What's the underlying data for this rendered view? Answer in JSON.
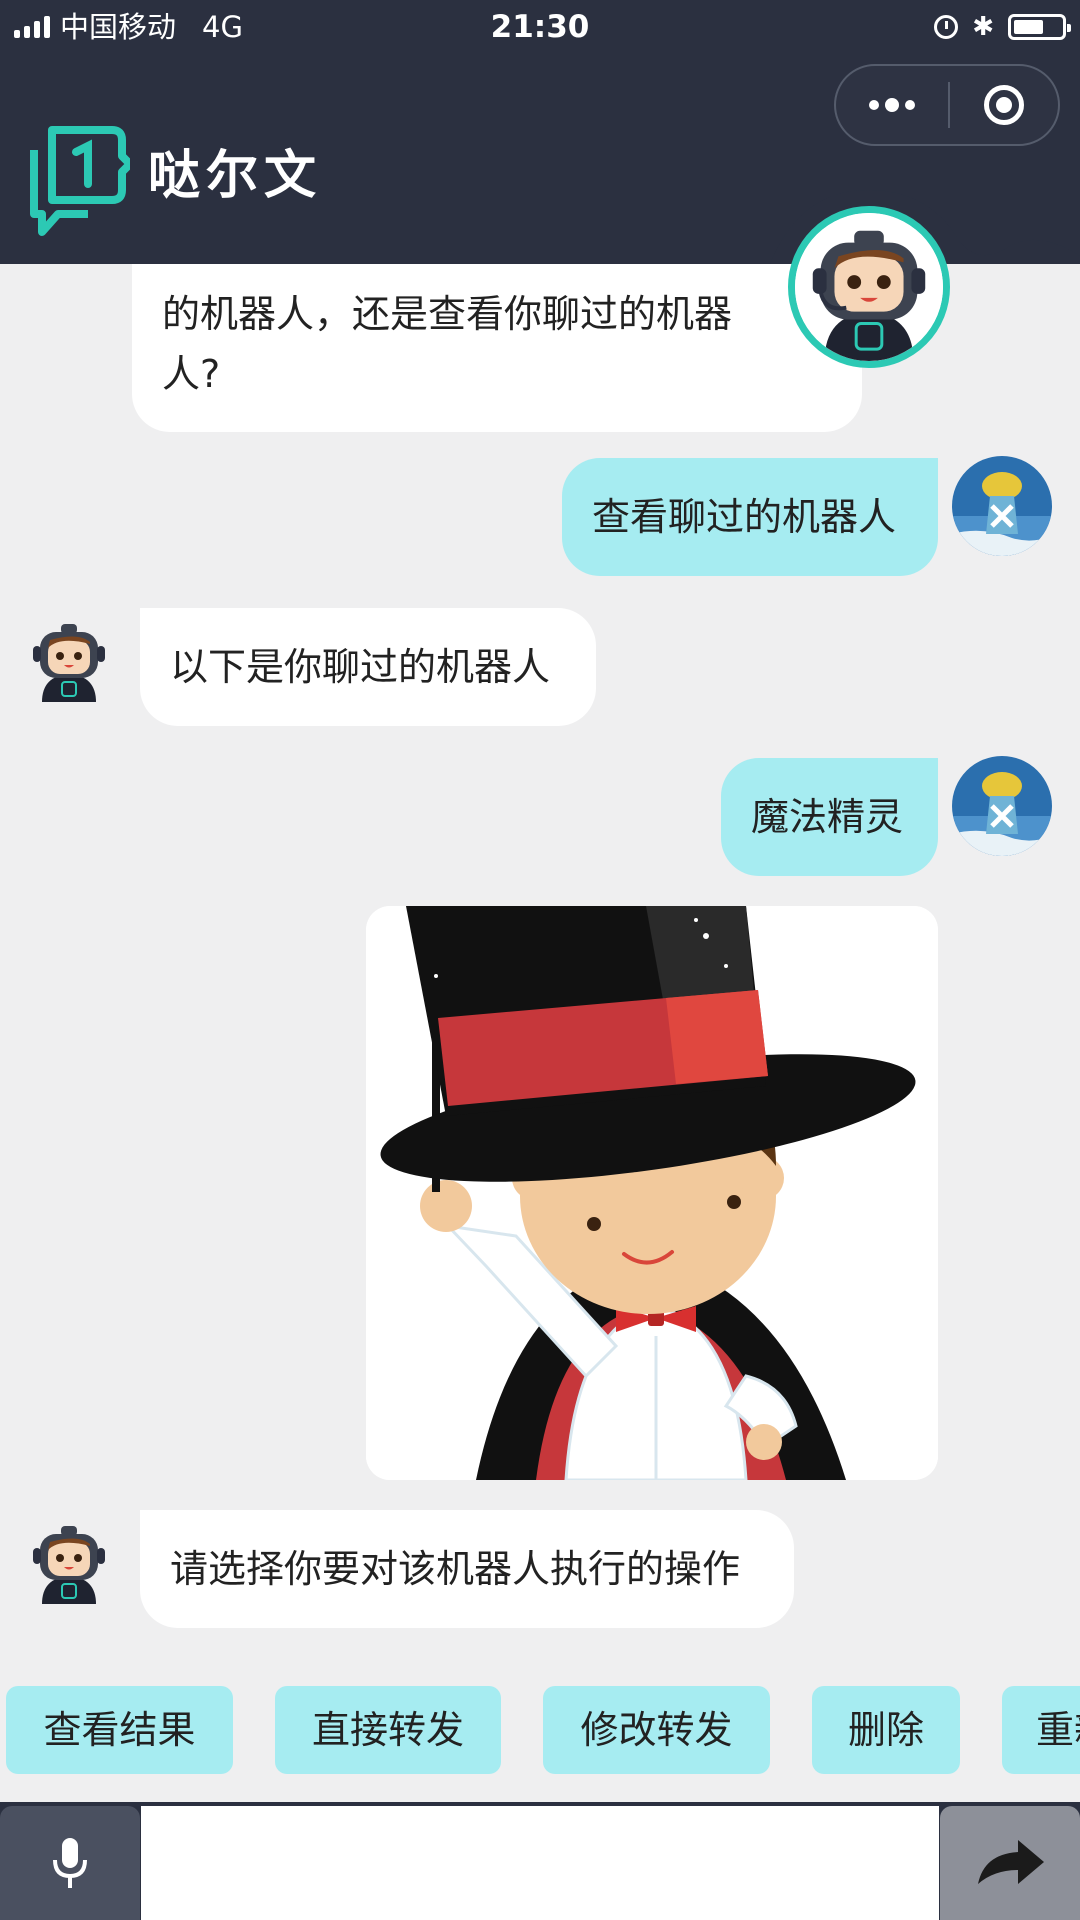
{
  "status_bar": {
    "carrier": "中国移动",
    "network": "4G",
    "time": "21:30",
    "icons": [
      "signal-icon",
      "alarm-icon",
      "bluetooth-icon",
      "battery-icon"
    ],
    "battery_level": 0.55
  },
  "header": {
    "app_name": "哒尔文",
    "capsule": {
      "more_icon": "more-dots-icon",
      "close_icon": "target-close-icon"
    }
  },
  "messages": [
    {
      "sender": "bot",
      "text_line1": "的机器人，还是查看你聊过的机器",
      "text_line2": "人?"
    },
    {
      "sender": "user",
      "text": "查看聊过的机器人"
    },
    {
      "sender": "bot",
      "text": "以下是你聊过的机器人"
    },
    {
      "sender": "user",
      "text": "魔法精灵"
    },
    {
      "sender": "bot",
      "type": "image",
      "image_subject": "magician-boy"
    },
    {
      "sender": "bot",
      "text": "请选择你要对该机器人执行的操作"
    }
  ],
  "actions": [
    {
      "label": "查看结果"
    },
    {
      "label": "直接转发"
    },
    {
      "label": "修改转发"
    },
    {
      "label": "删除"
    },
    {
      "label": "重新"
    }
  ],
  "input_bar": {
    "voice_icon": "microphone-icon",
    "send_icon": "share-arrow-icon",
    "value": ""
  },
  "colors": {
    "header_bg": "#2b3040",
    "accent_teal": "#2cc9b4",
    "user_bubble": "#a6ecf1",
    "chip_bg": "#a6ecf1",
    "chat_bg": "#efeff0"
  }
}
